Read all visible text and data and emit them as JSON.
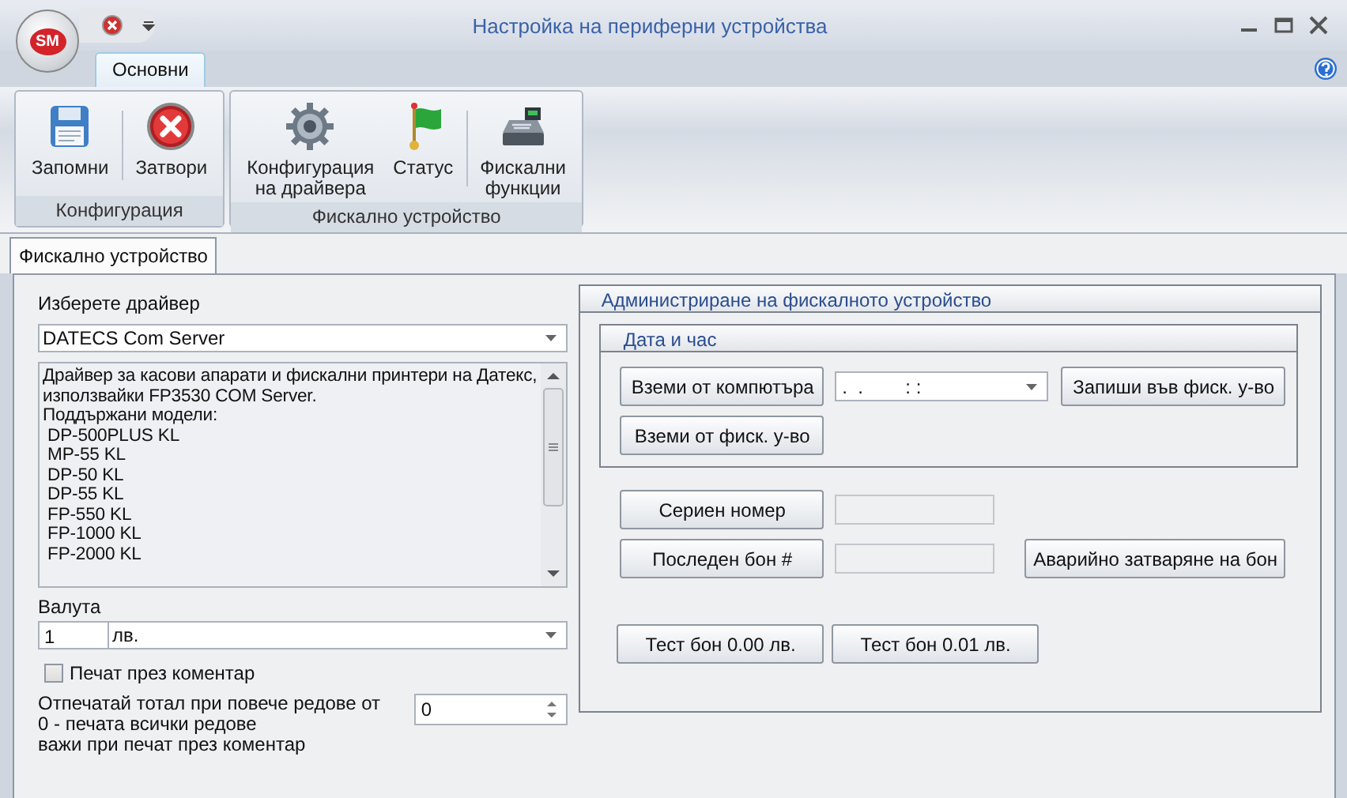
{
  "window": {
    "title": "Настройка на периферни устройства",
    "logo": "SM"
  },
  "ribbon": {
    "tabs": [
      {
        "label": "Основни",
        "selected": true
      }
    ],
    "groups": [
      {
        "label": "Конфигурация",
        "buttons": [
          {
            "label": "Запомни",
            "kind": "save",
            "separator_before": false
          },
          {
            "label": "Затвори",
            "kind": "close",
            "separator_before": true
          }
        ]
      },
      {
        "label": "Фискално устройство",
        "buttons": [
          {
            "label": "Конфигурация\nна драйвера",
            "kind": "gear",
            "separator_before": false
          },
          {
            "label": "Статус",
            "kind": "flag",
            "separator_before": false
          },
          {
            "label": "Фискални\nфункции",
            "kind": "register",
            "separator_before": true
          }
        ]
      }
    ]
  },
  "page_tabs": [
    {
      "label": "Фискално устройство",
      "selected": true
    }
  ],
  "driver": {
    "label": "Изберете драйвер",
    "value": "DATECS Com Server",
    "description": [
      "Драйвер за касови апарати и фискални принтери на Датекс,",
      "използвайки FP3530 COM Server.",
      "Поддържани модели:",
      " DP-500PLUS KL",
      " MP-55 KL",
      " DP-50 KL",
      " DP-55 KL",
      " FP-550 KL",
      " FP-1000 KL",
      " FP-2000 KL"
    ]
  },
  "currency": {
    "label": "Валута",
    "rate": "1",
    "value": "лв."
  },
  "print_comment": {
    "label": "Печат през коментар",
    "checked": false
  },
  "total_lines": {
    "label": "Отпечатай тотал при повече редове от",
    "hints": [
      "0 - печата всички редове",
      "важи при печат през коментар"
    ],
    "value": "0"
  },
  "admin": {
    "title": "Администриране на фискалното устройство",
    "datetime": {
      "title": "Дата и час",
      "get_pc": "Вземи от компютъра",
      "value": " .  .        : :",
      "write": "Запиши във фиск. у-во",
      "get_device": "Вземи от фиск. у-во"
    },
    "serial": {
      "button": "Сериен номер"
    },
    "last_receipt": {
      "button": "Последен бон #"
    },
    "emergency": "Аварийно затваряне на бон",
    "tests": [
      "Тест бон 0.00 лв.",
      "Тест бон 0.01 лв."
    ]
  }
}
